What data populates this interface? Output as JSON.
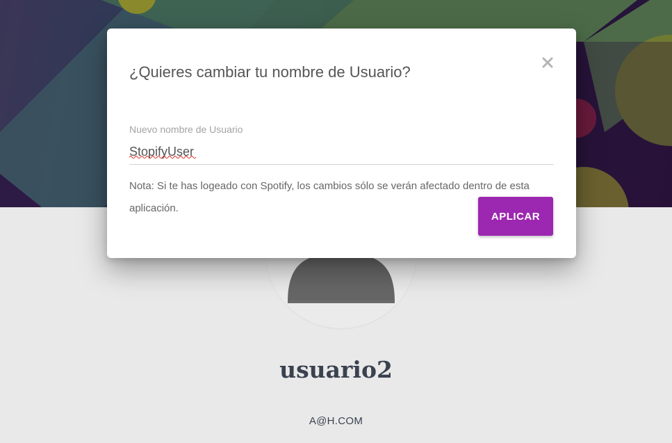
{
  "modal": {
    "title": "¿Quieres cambiar tu nombre de Usuario?",
    "close_icon": "close-icon",
    "field_label": "Nuevo nombre de Usuario",
    "field_value": "StopifyUser",
    "note": "Nota: Si te has logeado con Spotify, los cambios sólo se verán afectado dentro de esta aplicación.",
    "apply_label": "APLICAR"
  },
  "profile": {
    "avatar_icon": "user-avatar-icon",
    "username": "usuario2",
    "email": "A@H.COM"
  },
  "colors": {
    "accent": "#9c27b0",
    "banner_dark": "#27123a",
    "text_dark": "#3a4250"
  }
}
